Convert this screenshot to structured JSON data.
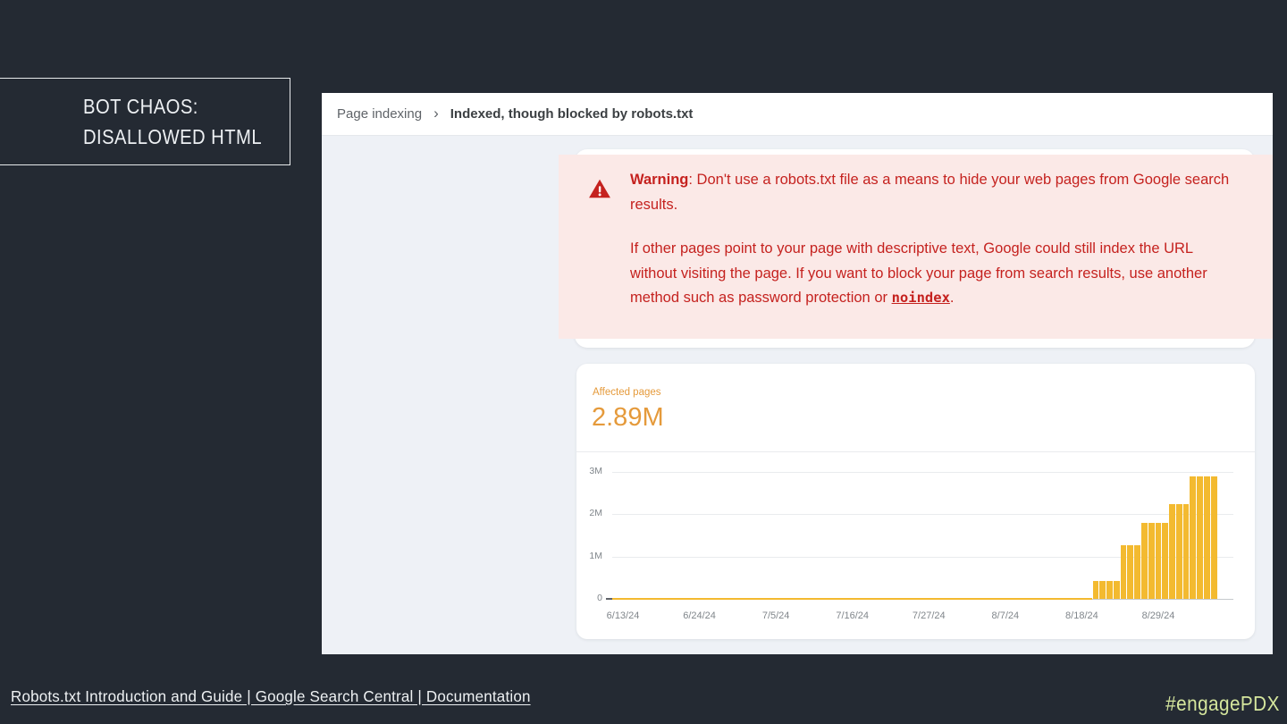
{
  "slide": {
    "title_line1": "Bot Chaos:",
    "title_line2": "Disallowed HTML",
    "footer_link": "Robots.txt Introduction and Guide | Google Search Central | Documentation",
    "hashtag": "#engagePDX",
    "colors": {
      "background": "#242a33",
      "accent_green": "#d5e69d"
    }
  },
  "console": {
    "breadcrumb": {
      "parent": "Page indexing",
      "separator": "›",
      "current": "Indexed, though blocked by robots.txt"
    },
    "warning": {
      "icon": "warning-triangle-icon",
      "label": "Warning",
      "text_after_label": ": Don't use a robots.txt file as a means to hide your web pages from Google search results.",
      "paragraph2_before_link": "If other pages point to your page with descriptive text, Google could still index the URL without visiting the page. If you want to block your page from search results, use another method such as password protection or ",
      "link_text": "noindex",
      "paragraph2_after_link": ".",
      "colors": {
        "background": "#fbe9e7",
        "text": "#c5221f",
        "icon": "#c5221f"
      }
    },
    "metric": {
      "label": "Affected pages",
      "value": "2.89M",
      "color": "#e59a3b"
    }
  },
  "chart_data": {
    "type": "bar",
    "title": "Affected pages over time",
    "metric_label": "Affected pages",
    "latest_value_label": "2.89M",
    "xlabel": "",
    "ylabel": "",
    "ylim": [
      0,
      3000000
    ],
    "grid": true,
    "bar_color": "#f3ba30",
    "x_tick_labels": [
      "6/13/24",
      "6/24/24",
      "7/5/24",
      "7/16/24",
      "7/27/24",
      "8/7/24",
      "8/18/24",
      "8/29/24"
    ],
    "y_ticks": [
      {
        "label": "3M",
        "value": 3000000
      },
      {
        "label": "2M",
        "value": 2000000
      },
      {
        "label": "1M",
        "value": 1000000
      },
      {
        "label": "0",
        "value": 0
      }
    ],
    "daily_segments": [
      {
        "start_date": "6/13/24",
        "end_date": "8/19/24",
        "days": 68,
        "value": 0
      },
      {
        "start_date": "8/20/24",
        "end_date": "8/23/24",
        "days": 4,
        "value": 430000
      },
      {
        "start_date": "8/24/24",
        "end_date": "8/26/24",
        "days": 3,
        "value": 1270000
      },
      {
        "start_date": "8/27/24",
        "end_date": "8/30/24",
        "days": 4,
        "value": 1800000
      },
      {
        "start_date": "8/31/24",
        "end_date": "9/2/24",
        "days": 3,
        "value": 2240000
      },
      {
        "start_date": "9/3/24",
        "end_date": "9/6/24",
        "days": 4,
        "value": 2890000
      }
    ]
  }
}
